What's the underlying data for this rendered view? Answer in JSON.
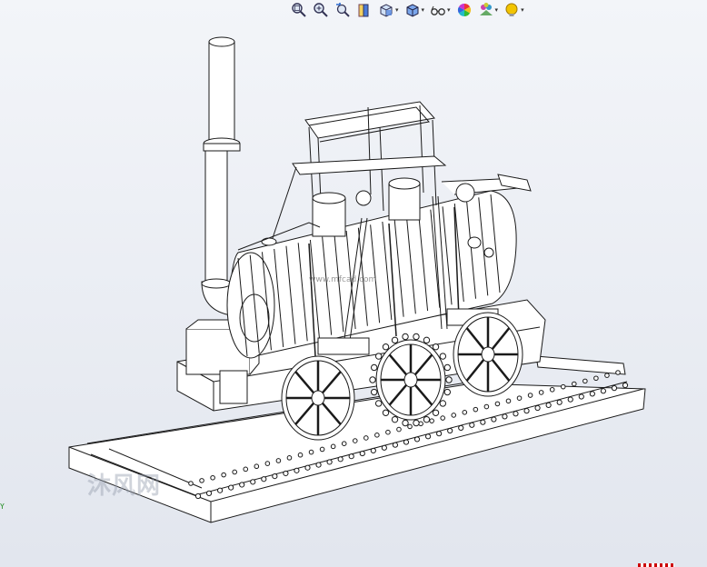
{
  "window": {
    "background_top": "#f3f5f9",
    "background_bottom": "#e2e6ee"
  },
  "toolbar": {
    "buttons": [
      {
        "name": "zoom-to-fit-button",
        "icon": "magnifier-fit-icon",
        "dropdown": false
      },
      {
        "name": "zoom-to-area-button",
        "icon": "magnifier-area-icon",
        "dropdown": false
      },
      {
        "name": "previous-view-button",
        "icon": "previous-view-icon",
        "dropdown": false
      },
      {
        "name": "section-view-button",
        "icon": "section-view-icon",
        "dropdown": false
      },
      {
        "name": "view-orientation-button",
        "icon": "view-orientation-icon",
        "dropdown": true
      },
      {
        "name": "display-style-button",
        "icon": "display-style-cube-icon",
        "dropdown": true
      },
      {
        "name": "hide-show-items-button",
        "icon": "eye-glasses-icon",
        "dropdown": true
      },
      {
        "name": "edit-appearance-button",
        "icon": "color-wheel-icon",
        "dropdown": false
      },
      {
        "name": "apply-scene-button",
        "icon": "scene-icon",
        "dropdown": true
      },
      {
        "name": "view-settings-button",
        "icon": "light-bulb-icon",
        "dropdown": true
      }
    ],
    "caret": "▾"
  },
  "axis": {
    "label": "Y"
  },
  "model": {
    "name": "steam-locomotive-model",
    "line_color": "#1a1a1a",
    "fill_color": "#ffffff"
  },
  "watermark": {
    "text": "沐风网",
    "url": "www.mfcad.com"
  }
}
